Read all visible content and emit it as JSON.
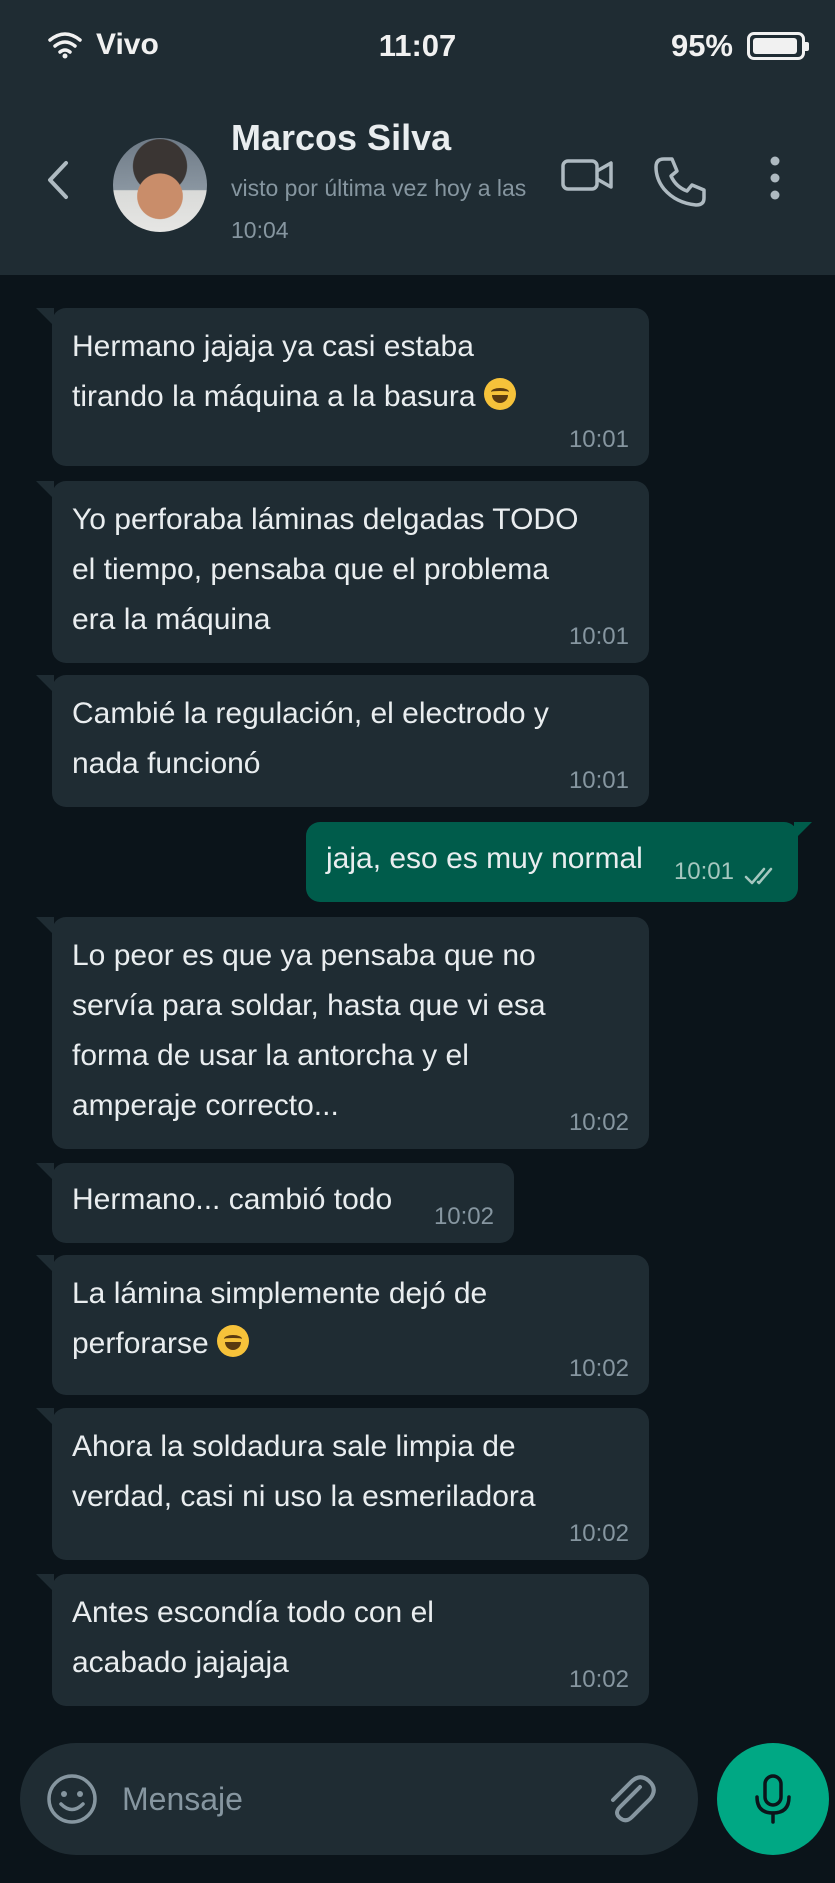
{
  "status_bar": {
    "carrier": "Vivo",
    "time": "11:07",
    "battery_text": "95%",
    "battery_level": 0.95
  },
  "header": {
    "contact_name": "Marcos Silva",
    "last_seen": "visto por última vez hoy a las 10:04"
  },
  "messages": [
    {
      "dir": "in",
      "lines": [
        "Hermano jajaja ya casi estaba",
        "tirando la máquina a la basura"
      ],
      "emoji": true,
      "time": "10:01"
    },
    {
      "dir": "in",
      "lines": [
        "Yo perforaba láminas delgadas TODO",
        "el tiempo, pensaba que el problema",
        "era la máquina"
      ],
      "time": "10:01"
    },
    {
      "dir": "in",
      "lines": [
        "Cambié la regulación, el electrodo y",
        "nada funcionó"
      ],
      "time": "10:01"
    },
    {
      "dir": "out",
      "lines": [
        "jaja, eso es muy normal"
      ],
      "time": "10:01"
    },
    {
      "dir": "in",
      "lines": [
        "Lo peor es que ya pensaba que no",
        "servía para soldar, hasta que vi esa",
        "forma de usar la antorcha y el",
        "amperaje correcto..."
      ],
      "time": "10:02"
    },
    {
      "dir": "in",
      "lines": [
        "Hermano... cambió todo"
      ],
      "time": "10:02"
    },
    {
      "dir": "in",
      "lines": [
        "La lámina simplemente dejó de",
        "perforarse"
      ],
      "emoji": true,
      "time": "10:02"
    },
    {
      "dir": "in",
      "lines": [
        "Ahora la soldadura sale limpia de",
        "verdad, casi ni uso la esmeriladora"
      ],
      "time": "10:02"
    },
    {
      "dir": "in",
      "lines": [
        "Antes escondía todo con el",
        "acabado jajajaja"
      ],
      "time": "10:02"
    }
  ],
  "input": {
    "placeholder": "Mensaje"
  },
  "colors": {
    "background": "#0b141a",
    "bar": "#1f2c33",
    "incoming_bubble": "#1f2c33",
    "outgoing_bubble": "#005c4b",
    "accent": "#00a884"
  }
}
